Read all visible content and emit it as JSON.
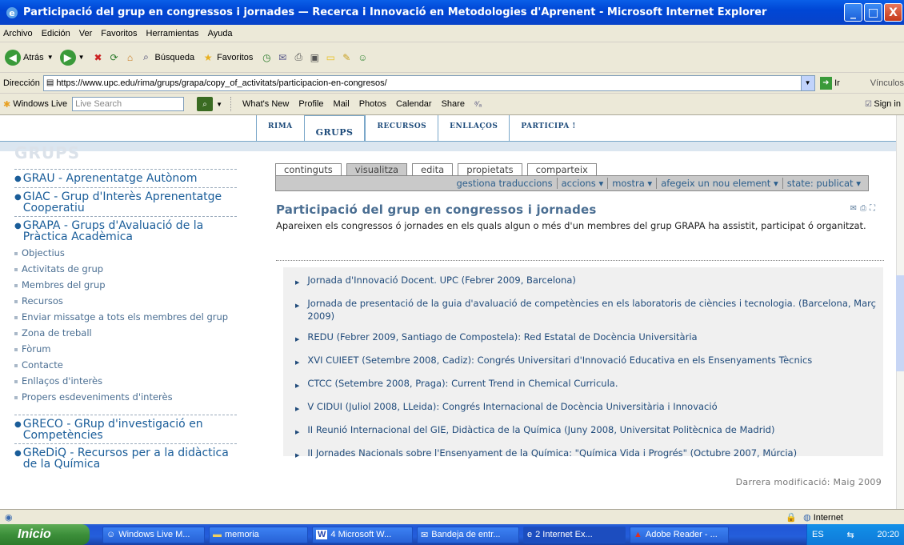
{
  "window": {
    "title": "Participació del grup en congressos i jornades — Recerca i Innovació en Metodologies d'Aprenent - Microsoft Internet Explorer",
    "buttons": [
      "_",
      "□",
      "X"
    ]
  },
  "menu": [
    "Archivo",
    "Edición",
    "Ver",
    "Favoritos",
    "Herramientas",
    "Ayuda"
  ],
  "toolbar": {
    "back_label": "Atrás",
    "search_label": "Búsqueda",
    "favorites_label": "Favoritos"
  },
  "address": {
    "label": "Dirección",
    "url": "https://www.upc.edu/rima/grups/grapa/copy_of_activitats/participacion-en-congresos/",
    "go_label": "Ir",
    "links_label": "Vínculos"
  },
  "livebar": {
    "brand": "Windows Live",
    "search_placeholder": "Live Search",
    "links": [
      "What's New",
      "Profile",
      "Mail",
      "Photos",
      "Calendar",
      "Share"
    ],
    "signin": "Sign in"
  },
  "site_nav": [
    "RIMA",
    "GRUPS",
    "RECURSOS",
    "ENLLAÇOS",
    "PARTICIPA !"
  ],
  "site_nav_active": "GRUPS",
  "sidebar": {
    "header": "GRUPS",
    "groups": [
      {
        "label": "GRAU - Aprenentatge Autònom",
        "subs": []
      },
      {
        "label": "GIAC - Grup d'Interès Aprenentatge Cooperatiu",
        "subs": []
      },
      {
        "label": "GRAPA - Grups d'Avaluació de la Pràctica Acadèmica",
        "subs": [
          "Objectius",
          "Activitats de grup",
          "Membres del grup",
          "Recursos",
          "Enviar missatge a tots els membres del grup",
          "Zona de treball",
          "Fòrum",
          "Contacte",
          "Enllaços d'interès",
          "Propers esdeveniments d'interès"
        ]
      },
      {
        "label": "GRECO - GRup d'investigació en Competències",
        "subs": []
      },
      {
        "label": "GReDiQ - Recursos per a la didàctica de la Química",
        "subs": []
      }
    ]
  },
  "edit_tabs": [
    "continguts",
    "visualitza",
    "edita",
    "propietats",
    "comparteix"
  ],
  "edit_tab_active": "visualitza",
  "action_menu": [
    "gestiona traduccions",
    "accions ▾",
    "mostra ▾",
    "afegeix un nou element ▾",
    "state: publicat ▾"
  ],
  "page": {
    "title": "Participació del grup en congressos i jornades",
    "description": "Apareixen els congressos ó jornades en els quals algun o més d'un membres del grup GRAPA ha assistit, participat ó organitzat.",
    "items": [
      "Jornada d'Innovació Docent. UPC (Febrer 2009, Barcelona)",
      "Jornada de presentació de la guia d'avaluació de competències en els laboratoris de ciències i tecnologia. (Barcelona, Març 2009)",
      "REDU (Febrer 2009, Santiago de Compostela): Red Estatal de Docència Universitària",
      "XVI CUIEET (Setembre 2008, Cadiz): Congrés Universitari d'Innovació Educativa en els Ensenyaments Tècnics",
      "CTCC (Setembre 2008, Praga): Current Trend in Chemical Curricula.",
      "V CIDUI (Juliol 2008, LLeida): Congrés Internacional de Docència Universitària i Innovació",
      "II Reunió Internacional del GIE, Didàctica de la Química (Juny 2008, Universitat Politècnica de Madrid)",
      "II Jornades Nacionals sobre l'Ensenyament de la Química: \"Química Vida i Progrés\" (Octubre 2007, Múrcia)"
    ],
    "last_modified": "Darrera modificació: Maig 2009"
  },
  "status": {
    "zone": "Internet"
  },
  "taskbar": {
    "start": "Inicio",
    "tasks": [
      "Windows Live M...",
      "memoria",
      "4 Microsoft W...",
      "Bandeja de entr...",
      "2 Internet Ex...",
      "Adobe Reader - ..."
    ],
    "lang": "ES",
    "time": "20:20"
  }
}
